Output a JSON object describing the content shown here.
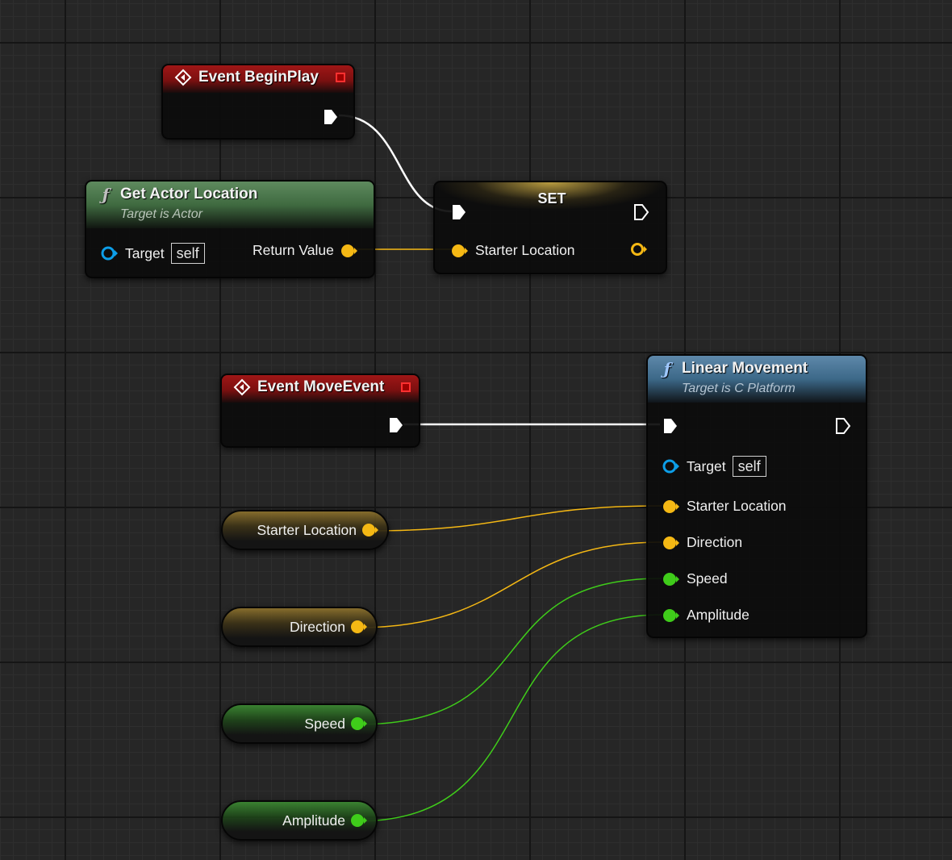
{
  "colors": {
    "exec": "#ffffff",
    "vector": "#f5b814",
    "float": "#3fcc1a",
    "object": "#0d9ee8",
    "event_header": "#a01616",
    "function_header_pure": "#3f6a40",
    "function_header_call": "#3c6888",
    "set_header": "#d6b448"
  },
  "nodes": {
    "begin_play": {
      "title": "Event BeginPlay",
      "icon": "event-diamond-icon"
    },
    "get_actor_location": {
      "title": "Get Actor Location",
      "subtitle": "Target is Actor",
      "target_label": "Target",
      "target_default": "self",
      "return_label": "Return Value"
    },
    "set": {
      "title": "SET",
      "var_label": "Starter Location"
    },
    "move_event": {
      "title": "Event MoveEvent",
      "icon": "event-diamond-icon"
    },
    "linear_movement": {
      "title": "Linear Movement",
      "subtitle": "Target is C Platform",
      "target_label": "Target",
      "target_default": "self",
      "inputs": [
        "Starter Location",
        "Direction",
        "Speed",
        "Amplitude"
      ]
    },
    "vars": [
      {
        "label": "Starter Location",
        "type": "vector"
      },
      {
        "label": "Direction",
        "type": "vector"
      },
      {
        "label": "Speed",
        "type": "float"
      },
      {
        "label": "Amplitude",
        "type": "float"
      }
    ]
  }
}
